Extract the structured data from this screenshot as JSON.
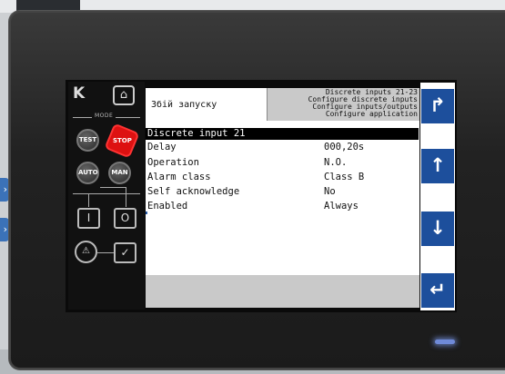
{
  "controller": {
    "logo": "K",
    "mode_label": "MODE",
    "buttons": {
      "test": "TEST",
      "stop": "STOP",
      "auto": "AUTO",
      "man": "MAN",
      "on": "I",
      "off": "O",
      "alarm": "⚠",
      "ack": "✓",
      "home": "⌂"
    }
  },
  "screen": {
    "left_header": "Збій запуску",
    "right_header_lines": [
      "Discrete inputs 21-23",
      "Configure discrete inputs",
      "Configure inputs/outputs",
      "Configure application"
    ],
    "selected_item": "Discrete input 21",
    "rows": [
      {
        "label": "Delay",
        "value": "000,20s"
      },
      {
        "label": "Operation",
        "value": "N.O."
      },
      {
        "label": "Alarm class",
        "value": "Class B"
      },
      {
        "label": "Self acknowledge",
        "value": "No"
      },
      {
        "label": "Enabled",
        "value": "Always"
      }
    ]
  },
  "nav": {
    "back": "↱",
    "up": "↑",
    "down": "↓",
    "enter": "↵"
  },
  "colors": {
    "nav_blue": "#1d4f9c",
    "stop_red": "#d11111",
    "header_gray": "#c9c9c9"
  }
}
